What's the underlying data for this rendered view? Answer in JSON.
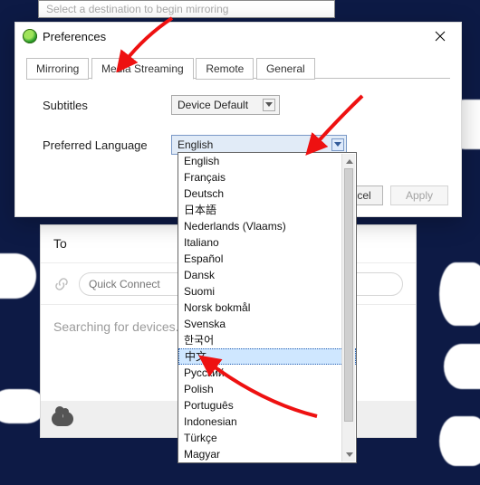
{
  "top_field": {
    "placeholder": "Select a destination to begin mirroring"
  },
  "prefs": {
    "title": "Preferences",
    "tabs": [
      "Mirroring",
      "Media Streaming",
      "Remote",
      "General"
    ],
    "active_tab": 1,
    "subtitles": {
      "label": "Subtitles",
      "value": "Device Default"
    },
    "language": {
      "label": "Preferred Language",
      "value": "English"
    },
    "buttons": {
      "cancel": "Cancel",
      "apply": "Apply"
    }
  },
  "dropdown": {
    "options": [
      "English",
      "Français",
      "Deutsch",
      "日本語",
      "Nederlands (Vlaams)",
      "Italiano",
      "Español",
      "Dansk",
      "Suomi",
      "Norsk bokmål",
      "Svenska",
      "한국어",
      "中文",
      "Русский",
      "Polish",
      "Português",
      "Indonesian",
      "Türkçe",
      "Magyar"
    ],
    "highlighted_index": 12
  },
  "card": {
    "title": "To",
    "quick_connect_placeholder": "Quick Connect",
    "status": "Searching for devices..."
  }
}
